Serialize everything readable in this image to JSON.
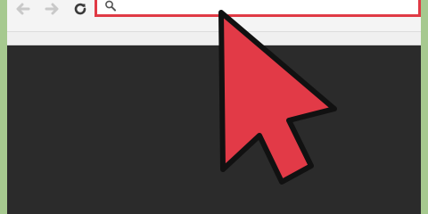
{
  "browser": {
    "toolbar": {
      "back_icon": "arrow-left-icon",
      "forward_icon": "arrow-right-icon",
      "reload_icon": "reload-icon"
    },
    "address_bar": {
      "value": "",
      "placeholder": "",
      "search_icon": "search-icon",
      "highlight_color": "#e03a45"
    },
    "content": {
      "background": "#2b2b2b"
    }
  },
  "overlay": {
    "cursor_icon": "mouse-pointer-icon",
    "cursor_color": "#e23a47"
  }
}
